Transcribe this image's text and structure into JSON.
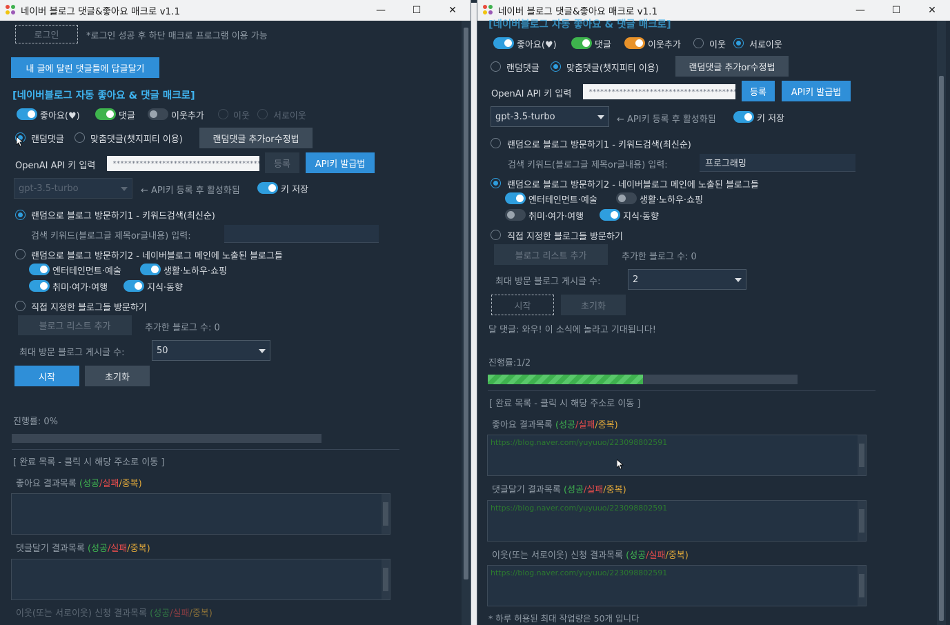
{
  "app": {
    "title": "네이버 블로그 댓글&좋아요 매크로 v1.1"
  },
  "window_controls": {
    "minimize": "—",
    "maximize": "☐",
    "close": "✕"
  },
  "left": {
    "login_button": "로그인",
    "login_note": "*로그인 성공 후 하단 매크로 프로그램 이용 가능",
    "reply_button": "내 글에 달린 댓글들에 답글달기",
    "section_title": "[네이버블로그 자동 좋아요 & 댓글 매크로]",
    "toggles": {
      "like": "좋아요(♥)",
      "comment": "댓글",
      "add_neighbor": "이웃추가"
    },
    "neighbor_radios": {
      "neighbor": "이웃",
      "mutual": "서로이웃"
    },
    "comment_mode": {
      "random": "랜덤댓글",
      "custom": "맞춤댓글(챗지피티 이용)",
      "edit_button": "랜덤댓글 추가or수정법"
    },
    "openai": {
      "label": "OpenAI API 키 입력",
      "value": "******************************************",
      "register": "등록",
      "issue": "API키 발급법"
    },
    "model": {
      "value": "gpt-3.5-turbo",
      "hint": "← API키 등록 후 활성화됨",
      "save_key": "키 저장"
    },
    "visit1": {
      "label": "랜덤으로 블로그 방문하기1 - 키워드검색(최신순)",
      "keyword_label": "검색 키워드(블로그글 제목or글내용) 입력:",
      "keyword_value": ""
    },
    "visit2": {
      "label": "랜덤으로 블로그 방문하기2 - 네이버블로그 메인에 노출된 블로그들",
      "cats": [
        "엔터테인먼트·예술",
        "생활·노하우·쇼핑",
        "취미·여가·여행",
        "지식·동향"
      ]
    },
    "visit3": {
      "label": "직접 지정한 블로그들 방문하기",
      "add_button": "블로그 리스트 추가",
      "count_label": "추가한 블로그 수: 0"
    },
    "max_posts": {
      "label": "최대 방문 블로그 게시글 수:",
      "value": "50"
    },
    "start": "시작",
    "reset": "초기화",
    "progress": {
      "label": "진행률: 0%",
      "value": 0
    },
    "done_header": "[ 완료 목록 - 클릭 시 해당 주소로 이동 ]",
    "like_results": "좋아요 결과목록",
    "comment_results": "댓글달기 결과목록",
    "neighbor_results": "이웃(또는 서로이웃) 신청 결과목록",
    "legend": {
      "success": "(성공",
      "fail": "/실패",
      "dup": "/중복)"
    }
  },
  "right": {
    "section_title": "[네이버블로그 자동 좋아요 & 댓글 매크로]",
    "toggles": {
      "like": "좋아요(♥)",
      "comment": "댓글",
      "add_neighbor": "이웃추가"
    },
    "neighbor_radios": {
      "neighbor": "이웃",
      "mutual": "서로이웃"
    },
    "comment_mode": {
      "random": "랜덤댓글",
      "custom": "맞춤댓글(챗지피티 이용)",
      "edit_button": "랜덤댓글 추가or수정법"
    },
    "openai": {
      "label": "OpenAI API 키 입력",
      "value": "******************************************",
      "register": "등록",
      "issue": "API키 발급법"
    },
    "model": {
      "value": "gpt-3.5-turbo",
      "hint": "← API키 등록 후 활성화됨",
      "save_key": "키 저장"
    },
    "visit1": {
      "label": "랜덤으로 블로그 방문하기1 - 키워드검색(최신순)",
      "keyword_label": "검색 키워드(블로그글 제목or글내용) 입력:",
      "keyword_value": "프로그래밍"
    },
    "visit2": {
      "label": "랜덤으로 블로그 방문하기2 - 네이버블로그 메인에 노출된 블로그들",
      "cats": [
        "엔터테인먼트·예술",
        "생활·노하우·쇼핑",
        "취미·여가·여행",
        "지식·동향"
      ]
    },
    "visit3": {
      "label": "직접 지정한 블로그들 방문하기",
      "add_button": "블로그 리스트 추가",
      "count_label": "추가한 블로그 수: 0"
    },
    "max_posts": {
      "label": "최대 방문 블로그 게시글 수:",
      "value": "2"
    },
    "start": "시작",
    "reset": "초기화",
    "last_comment": "달 댓글: 와우! 이 소식에 놀라고 기대됩니다!",
    "progress": {
      "label": "진행률:1/2",
      "value": 0.5
    },
    "done_header": "[ 완료 목록 - 클릭 시 해당 주소로 이동 ]",
    "like_results": "좋아요 결과목록",
    "comment_results": "댓글달기 결과목록",
    "neighbor_results": "이웃(또는 서로이웃) 신청 결과목록",
    "legend": {
      "success": "(성공",
      "fail": "/실패",
      "dup": "/중복)"
    },
    "like_url": "https://blog.naver.com/yuyuuo/223098802591",
    "comment_url": "https://blog.naver.com/yuyuuo/223098802591",
    "neighbor_url": "https://blog.naver.com/yuyuuo/223098802591",
    "footer_note": "* 하루 허용된 최대 작업량은 50개 입니다"
  },
  "colors": {
    "accent": "#2f8fd8",
    "success": "#3fb14f",
    "fail": "#e04b4b",
    "duplicate": "#e0a83a",
    "section": "#3fb4f0"
  }
}
